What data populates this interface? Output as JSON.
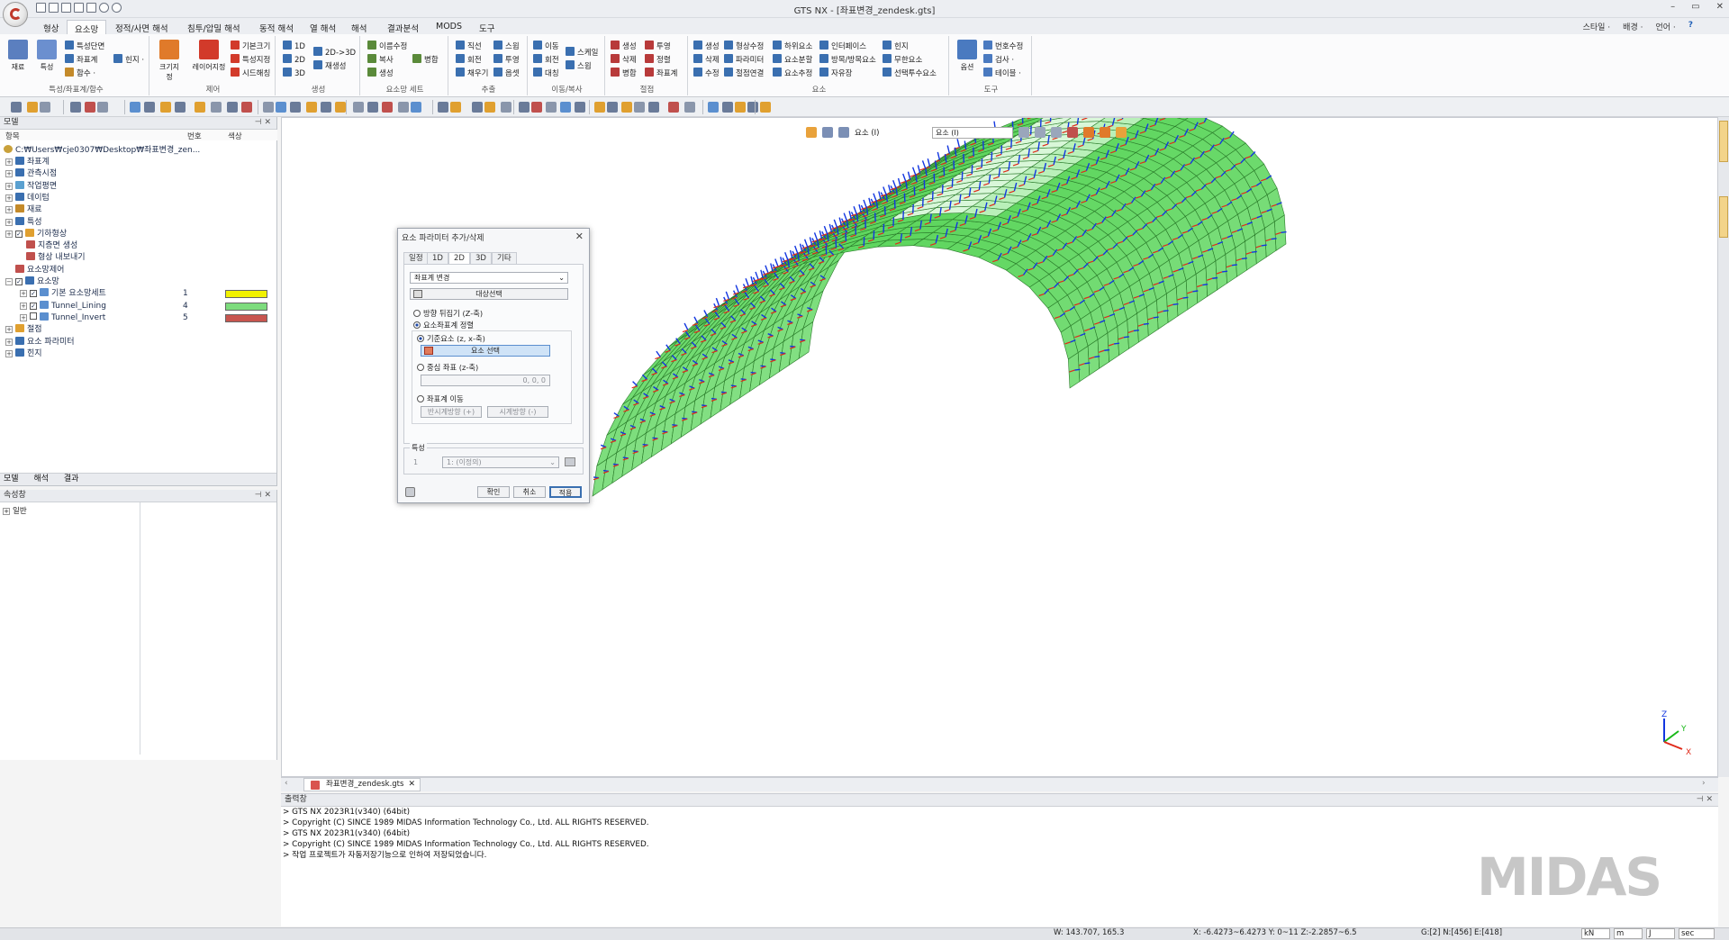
{
  "window": {
    "title": "GTS NX - [좌표변경_zendesk.gts]",
    "controls": [
      "–",
      "▭",
      "✕"
    ]
  },
  "menu": {
    "tabs": [
      "형상",
      "요소망",
      "정적/사면 해석",
      "침투/압밀 해석",
      "동적 해석",
      "열 해석",
      "해석",
      "결과분석",
      "MODS",
      "도구"
    ],
    "active_tab": "요소망",
    "right": [
      "스타일 ·",
      "배경 ·",
      "언어 ·",
      "?"
    ]
  },
  "ribbon": {
    "groups": [
      {
        "label": "특성/좌표계/함수",
        "big": [
          "재료",
          "특성"
        ],
        "small": [
          "특성단면",
          "좌표계",
          "함수 ·",
          "힌지 ·"
        ]
      },
      {
        "label": "제어",
        "big": [
          "크기지정",
          "레이어지정"
        ],
        "small": [
          "기본크기",
          "특성지정",
          "시드해칭"
        ]
      },
      {
        "label": "생성",
        "small": [
          "1D",
          "2D",
          "3D",
          "2D->3D",
          "재생성"
        ]
      },
      {
        "label": "요소망 세트",
        "small": [
          "이름수정",
          "복사",
          "생성",
          "병합"
        ]
      },
      {
        "label": "추출",
        "small": [
          "직선",
          "회전",
          "채우기",
          "스윕",
          "투영",
          "옵셋"
        ]
      },
      {
        "label": "이동/복사",
        "small": [
          "이동",
          "회전",
          "대칭",
          "스케일",
          "스윕"
        ]
      },
      {
        "label": "절점",
        "small": [
          "생성",
          "삭제",
          "병합",
          "투영",
          "정렬",
          "좌표계"
        ]
      },
      {
        "label": "요소",
        "small": [
          "생성",
          "삭제",
          "수정",
          "형상수정",
          "파라미터",
          "절점연결",
          "하위요소",
          "요소분할",
          "요소추정",
          "인터페이스",
          "방목/방목요소",
          "자유장",
          "힌지",
          "무한요소",
          "선택투수요소"
        ]
      },
      {
        "label": "도구",
        "big": [
          "옵션"
        ],
        "small": [
          "번호수정",
          "검사 ·",
          "테이블 ·"
        ]
      }
    ]
  },
  "model_panel": {
    "title": "모델",
    "columns": [
      "항목",
      "번호",
      "색상"
    ],
    "path": "C:₩Users₩cje0307₩Desktop₩좌표변경_zen...",
    "items": [
      "좌표계",
      "관측시점",
      "작업평면",
      "데이텀",
      "재료",
      "특성",
      "기하형상",
      "지층면 생성",
      "형상 내보내기",
      "요소망제어",
      "요소망",
      "절점",
      "요소 파라미터",
      "힌지"
    ],
    "mesh_sets": [
      {
        "name": "기본 요소망세트",
        "id": "1",
        "color": "#f2f200"
      },
      {
        "name": "Tunnel_Lining",
        "id": "4",
        "color": "#7ddc7d"
      },
      {
        "name": "Tunnel_Invert",
        "id": "5",
        "color": "#c8554f"
      }
    ],
    "tabs": [
      "모델",
      "해석",
      "결과"
    ]
  },
  "props_panel": {
    "title": "속성창",
    "items": [
      "일반"
    ]
  },
  "viewport": {
    "select_label": "요소 (I)",
    "filter_value": "요소 (I)",
    "axes": {
      "z": "Z",
      "y": "Y",
      "x": "X"
    }
  },
  "dialog": {
    "title": "요소 파라미터 추가/삭제",
    "tabs": [
      "일정",
      "1D",
      "2D",
      "3D",
      "기타"
    ],
    "active_tab": "2D",
    "mode": "좌표계 변경",
    "target_button": "대상선택",
    "option_flip": "방향 뒤집기 (Z-축)",
    "option_align": "요소좌표계 정렬",
    "option_ref": "기준요소 (z, x-축)",
    "ref_button": "요소 선택",
    "option_center": "중심 좌표 (z-축)",
    "center_value": "0, 0, 0",
    "option_move": "좌표계 이동",
    "ccw_button": "반시계방향 (+)",
    "cw_button": "시계방향 (-)",
    "property_label": "특성",
    "property_id": "1",
    "property_value": "1: (이정의)",
    "ok": "확인",
    "cancel": "취소",
    "apply": "적용"
  },
  "doc_tab": {
    "label": "좌표변경_zendesk.gts"
  },
  "output": {
    "title": "출력창",
    "lines": [
      "> GTS NX 2023R1(v340) (64bit)",
      "> Copyright (C) SINCE 1989 MIDAS Information Technology Co., Ltd. ALL RIGHTS RESERVED.",
      "> GTS NX 2023R1(v340) (64bit)",
      "> Copyright (C) SINCE 1989 MIDAS Information Technology Co., Ltd. ALL RIGHTS RESERVED.",
      "> 작업 프로젝트가 자동저장기능으로 인하여 저장되었습니다."
    ],
    "watermark": "MIDAS"
  },
  "status": {
    "w": "W: 143.707, 165.3",
    "coords": "X: -6.4273~6.4273 Y: 0~11 Z:-2.2857~6.5",
    "counts": "G:[2] N:[456] E:[418]",
    "units": [
      "kN",
      "m",
      "J",
      "sec"
    ]
  },
  "colors": {
    "mesh": "#5fd65f",
    "mesh_edge": "#2a7a2a",
    "arrow_z": "#1236e0",
    "arrow_x": "#e02a1a"
  }
}
